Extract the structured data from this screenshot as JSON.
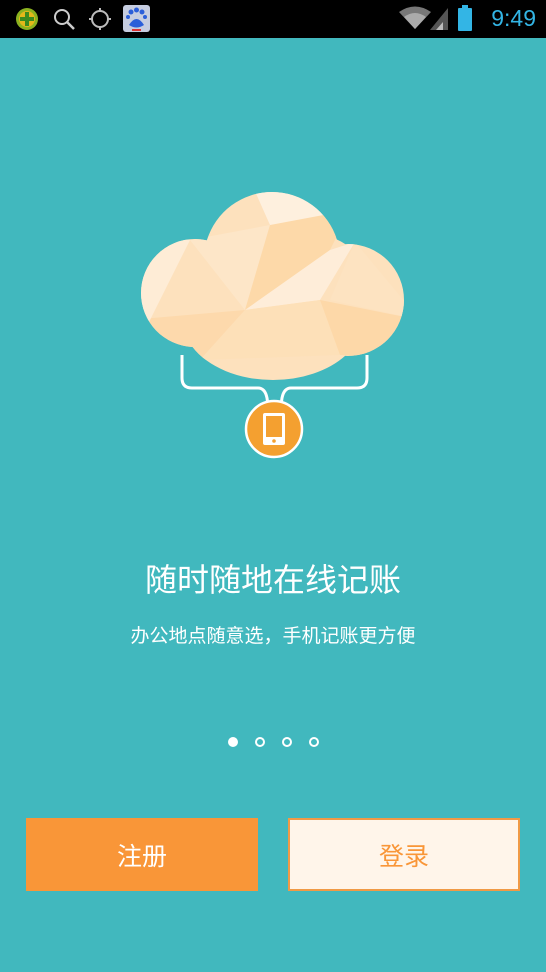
{
  "status_bar": {
    "time": "9:49",
    "notification_icons": [
      "360-security-icon",
      "search-icon",
      "gps-icon",
      "baidu-icon"
    ],
    "system_icons": [
      "wifi-icon",
      "cell-signal-icon",
      "battery-icon"
    ]
  },
  "onboarding": {
    "title": "随时随地在线记账",
    "subtitle": "办公地点随意选，手机记账更方便",
    "page_count": 4,
    "current_page": 1
  },
  "buttons": {
    "register_label": "注册",
    "login_label": "登录"
  },
  "colors": {
    "background": "#41b8be",
    "accent": "#f99638",
    "login_bg": "#fff5ea",
    "clock": "#33b5e5"
  }
}
